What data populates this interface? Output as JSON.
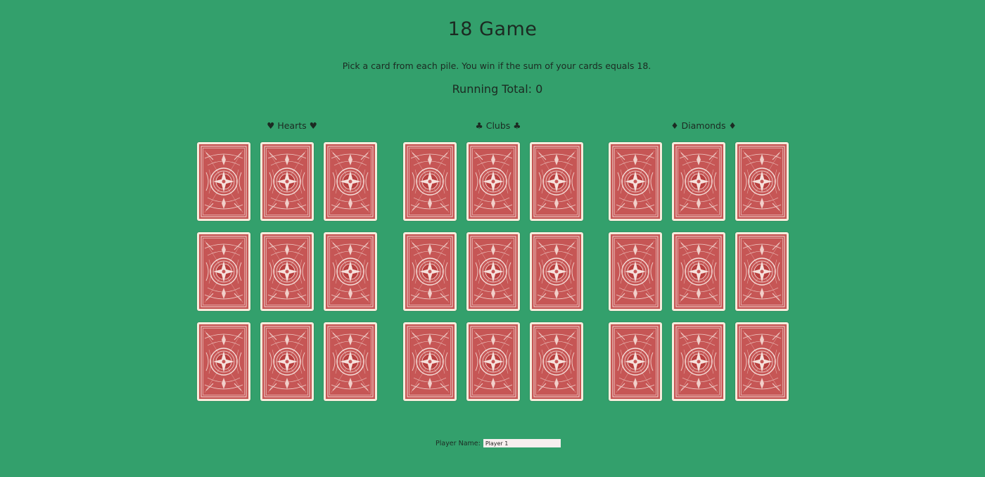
{
  "game": {
    "title": "18 Game",
    "instructions": "Pick a card from each pile. You win if the sum of your cards equals 18.",
    "running_total_label": "Running Total: 0"
  },
  "piles": [
    {
      "label": "♥ Hearts ♥",
      "suit": "hearts",
      "card_count": 9
    },
    {
      "label": "♣ Clubs ♣",
      "suit": "clubs",
      "card_count": 9
    },
    {
      "label": "♦ Diamonds ♦",
      "suit": "diamonds",
      "card_count": 9
    }
  ],
  "player": {
    "label": "Player Name:",
    "value": "Player 1"
  },
  "colors": {
    "table_green": "#33a06c",
    "card_back_red": "#c0504f",
    "card_border": "#f6ecdc"
  }
}
